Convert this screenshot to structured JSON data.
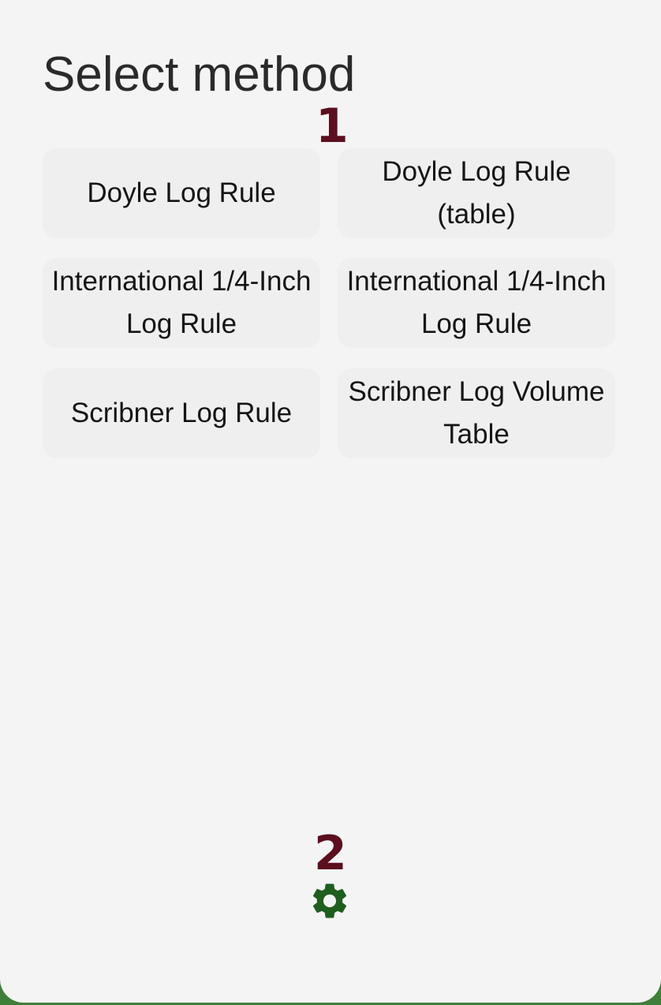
{
  "page": {
    "title": "Select method"
  },
  "markers": {
    "first": "1",
    "second": "2"
  },
  "methods": [
    {
      "label": "Doyle Log Rule"
    },
    {
      "label": "Doyle Log Rule (table)"
    },
    {
      "label": "International 1/4-Inch Log Rule"
    },
    {
      "label": "International 1/4-Inch Log Rule"
    },
    {
      "label": "Scribner Log Rule"
    },
    {
      "label": "Scribner Log Volume Table"
    }
  ],
  "settings": {
    "icon": "gear-icon",
    "color": "#1e5e1f"
  },
  "colors": {
    "frame": "#3f7f3a",
    "background": "#f4f4f4",
    "button": "#efefef",
    "marker": "#5c0f1f"
  }
}
